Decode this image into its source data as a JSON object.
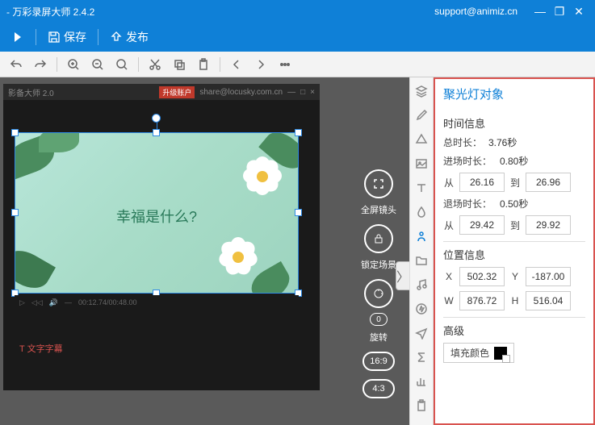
{
  "titlebar": {
    "app": "- 万彩录屏大师 2.4.2",
    "support": "support@animiz.cn"
  },
  "menubar": {
    "save": "保存",
    "publish": "发布"
  },
  "canvas": {
    "dark_title_left": "影备大师 2.0",
    "dark_title_url": "share@locusky.com.cn",
    "badge": "升级账户",
    "caption": "幸福是什么?",
    "timecode": "00:12.74/00:48.00",
    "subtitle": "T 文字字幕"
  },
  "cam": {
    "fullscreen": "全屏镜头",
    "lock": "锁定场景",
    "rotate": "旋转",
    "zero": "0",
    "ratio1": "16:9",
    "ratio2": "4:3"
  },
  "props": {
    "title": "聚光灯对象",
    "time_section": "时间信息",
    "total_label": "总时长：",
    "total_value": "3.76秒",
    "enter_label": "进场时长：",
    "enter_value": "0.80秒",
    "from": "从",
    "to": "到",
    "enter_from": "26.16",
    "enter_to": "26.96",
    "exit_label": "退场时长：",
    "exit_value": "0.50秒",
    "exit_from": "29.42",
    "exit_to": "29.92",
    "pos_section": "位置信息",
    "x": "X",
    "xv": "502.32",
    "y": "Y",
    "yv": "-187.00",
    "w": "W",
    "wv": "876.72",
    "h": "H",
    "hv": "516.04",
    "adv_section": "高级",
    "fill": "填充颜色"
  }
}
